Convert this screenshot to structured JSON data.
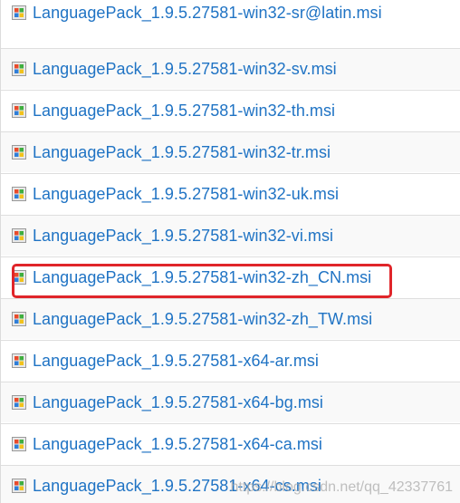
{
  "files": [
    {
      "name": "LanguagePack_1.9.5.27581-win32-sr@latin.msi",
      "icon": "msi-installer-icon"
    },
    {
      "name": "LanguagePack_1.9.5.27581-win32-sv.msi",
      "icon": "msi-installer-icon"
    },
    {
      "name": "LanguagePack_1.9.5.27581-win32-th.msi",
      "icon": "msi-installer-icon"
    },
    {
      "name": "LanguagePack_1.9.5.27581-win32-tr.msi",
      "icon": "msi-installer-icon"
    },
    {
      "name": "LanguagePack_1.9.5.27581-win32-uk.msi",
      "icon": "msi-installer-icon"
    },
    {
      "name": "LanguagePack_1.9.5.27581-win32-vi.msi",
      "icon": "msi-installer-icon"
    },
    {
      "name": "LanguagePack_1.9.5.27581-win32-zh_CN.msi",
      "icon": "msi-installer-icon"
    },
    {
      "name": "LanguagePack_1.9.5.27581-win32-zh_TW.msi",
      "icon": "msi-installer-icon"
    },
    {
      "name": "LanguagePack_1.9.5.27581-x64-ar.msi",
      "icon": "msi-installer-icon"
    },
    {
      "name": "LanguagePack_1.9.5.27581-x64-bg.msi",
      "icon": "msi-installer-icon"
    },
    {
      "name": "LanguagePack_1.9.5.27581-x64-ca.msi",
      "icon": "msi-installer-icon"
    },
    {
      "name": "LanguagePack_1.9.5.27581-x64-cs.msi",
      "icon": "msi-installer-icon"
    }
  ],
  "highlighted_file": "LanguagePack_1.9.5.27581-win32-zh_CN.msi",
  "watermark": "https://blog.csdn.net/qq_42337761",
  "colors": {
    "link": "#1f73c4",
    "highlight": "#e0252a",
    "row_alt_background": "#f9f9f9",
    "divider": "#dedede"
  }
}
